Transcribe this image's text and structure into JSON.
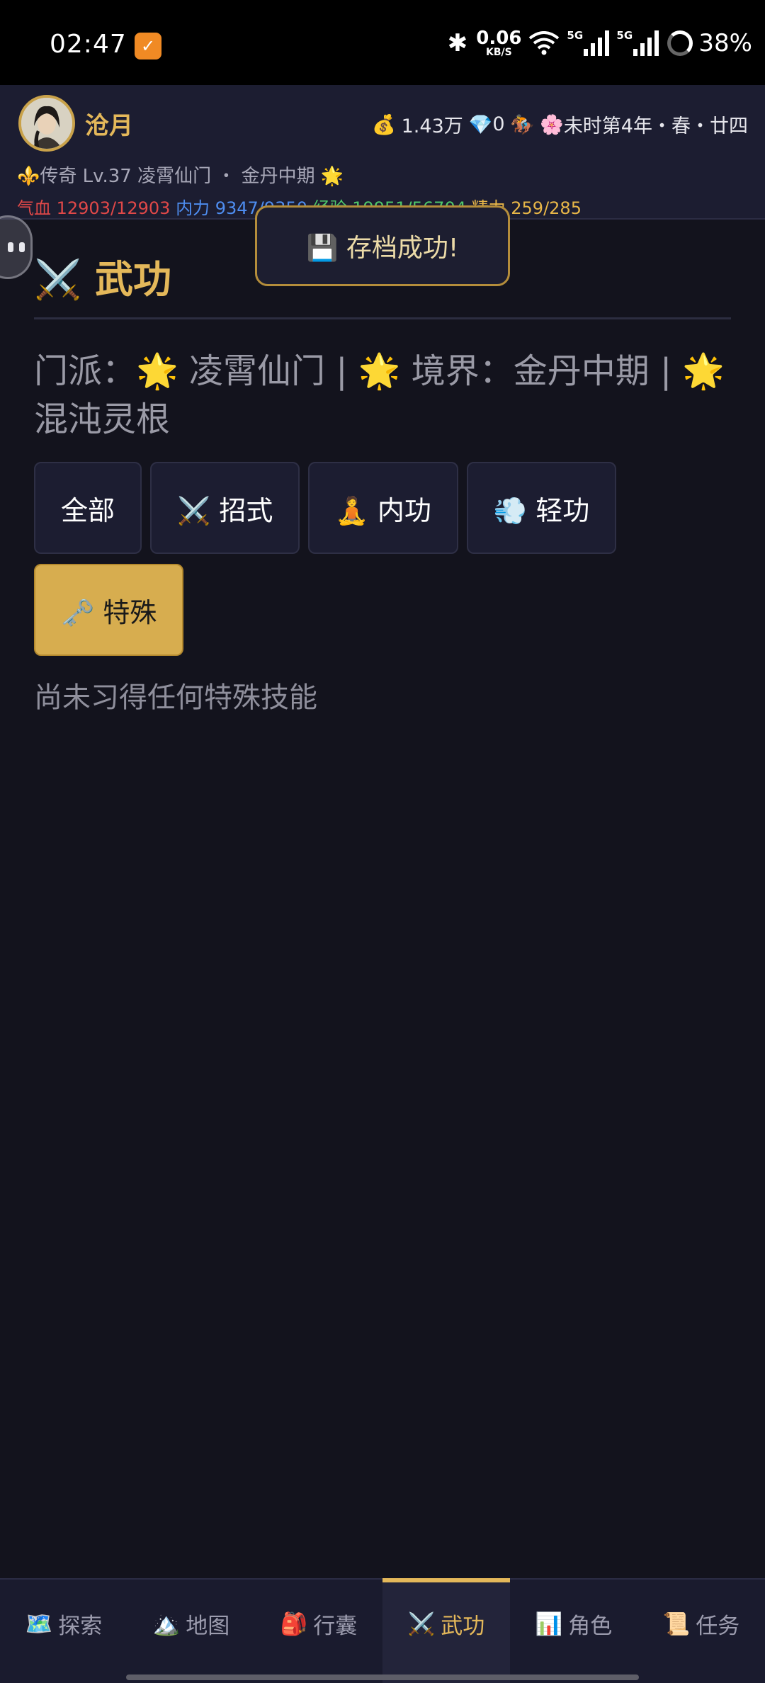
{
  "status_bar": {
    "time": "02:47",
    "speed_value": "0.06",
    "speed_unit": "KB/S",
    "net1": "5G",
    "net2": "5G",
    "battery": "38%"
  },
  "header": {
    "name": "沧月",
    "money_icon": "💰",
    "money": "1.43万",
    "gem_icon": "💎",
    "gems": "0",
    "mount_icon": "🏇",
    "flower_icon": "🌸",
    "time_of_day": "未时第4年・春・廿四",
    "title_icon": "⚜️",
    "profile": "传奇 Lv.37 凌霄仙门 ・ 金丹中期 🌟",
    "hp": "气血 12903/12903",
    "mp": "内力 9347/9350",
    "exp": "经验 19951/56704",
    "sp": "精力 259/285"
  },
  "toast": {
    "text": "💾 存档成功!"
  },
  "page": {
    "title": "⚔️ 武功",
    "info": "门派：🌟 凌霄仙门 | 🌟 境界：金丹中期 | 🌟 混沌灵根",
    "empty": "尚未习得任何特殊技能"
  },
  "filters": [
    {
      "label": "全部",
      "active": false
    },
    {
      "label": "⚔️ 招式",
      "active": false
    },
    {
      "label": "🧘 内功",
      "active": false
    },
    {
      "label": "💨 轻功",
      "active": false
    },
    {
      "label": "🗝️ 特殊",
      "active": true
    }
  ],
  "nav": [
    {
      "icon": "🗺️",
      "label": "探索",
      "active": false
    },
    {
      "icon": "🏔️",
      "label": "地图",
      "active": false
    },
    {
      "icon": "🎒",
      "label": "行囊",
      "active": false
    },
    {
      "icon": "⚔️",
      "label": "武功",
      "active": true
    },
    {
      "icon": "📊",
      "label": "角色",
      "active": false
    },
    {
      "icon": "📜",
      "label": "任务",
      "active": false
    }
  ],
  "colors": {
    "accent_gold": "#e4b85a",
    "hp": "#e04848",
    "mp": "#4e8df0",
    "exp": "#4ec86a",
    "sp": "#e7b648"
  }
}
